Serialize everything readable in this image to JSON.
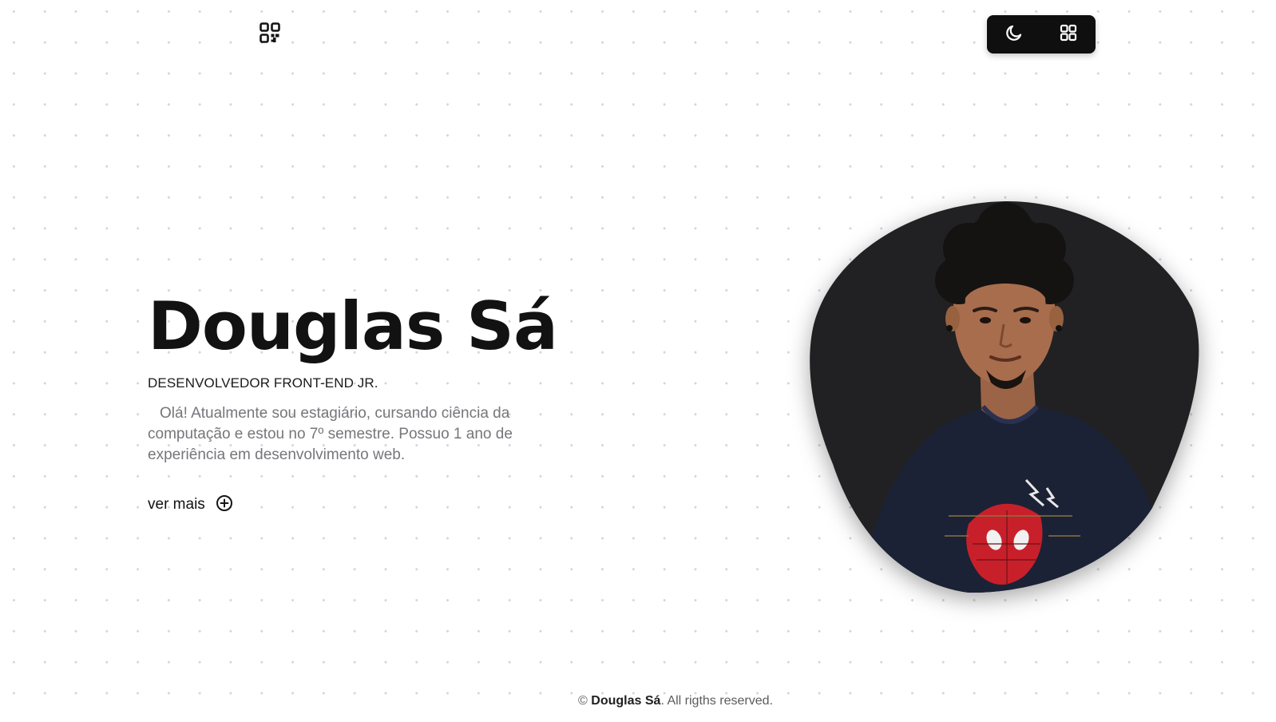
{
  "header": {
    "qr_icon": "qr-code-icon",
    "toolbar": {
      "theme_icon": "moon-icon",
      "menu_icon": "grid-menu-icon"
    }
  },
  "hero": {
    "name": "Douglas Sá",
    "role": "DESENVOLVEDOR FRONT-END JR.",
    "bio": "Olá! Atualmente sou estagiário, cursando ciência da computação e estou no 7º semestre. Possuo 1 ano de experiência em desenvolvimento web.",
    "more_label": "ver mais",
    "more_icon": "plus-circle-icon"
  },
  "photo": {
    "background_color": "#212123"
  },
  "footer": {
    "copyright_symbol": "©",
    "owner": "Douglas Sá",
    "rights": ". All rigths reserved."
  },
  "colors": {
    "background": "#ffffff",
    "dots": "#d4d4d4",
    "toolbar_bg": "#0f0f10",
    "text_primary": "#121212",
    "text_muted": "#76767b"
  }
}
